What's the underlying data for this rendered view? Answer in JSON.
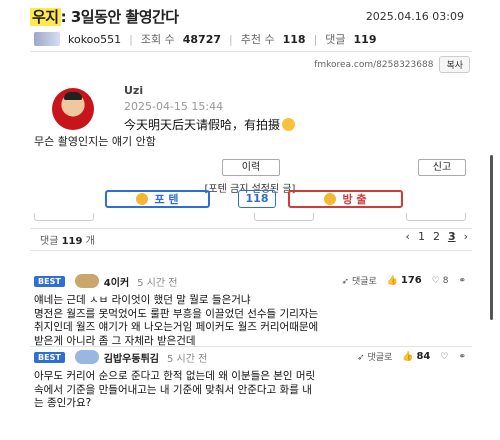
{
  "post": {
    "category": "우지",
    "title": ": 3일동안 촬영간다",
    "date": "2025.04.16 03:09",
    "author": "kokoo551",
    "views_label": "조회 수",
    "views": "48727",
    "recommend_label": "추천 수",
    "recommend": "118",
    "comments_label": "댓글",
    "comments": "119",
    "url": "fmkorea.com/8258323688",
    "copy_label": "복사"
  },
  "embed": {
    "username": "Uzi",
    "date": "2025-04-15 15:44",
    "text": "今天明天后天请假哈，有拍摄"
  },
  "caption": "무슨 촬영인지는 얘기 안함",
  "actions": {
    "history_label": "이력",
    "report_label": "신고",
    "notice": "[포텐 금지 설정된 글]",
    "upvote_label": "포 텐",
    "vote_count": "118",
    "downvote_label": "방 출"
  },
  "comment_bar": {
    "count_label": "댓글",
    "count": "119",
    "count_suffix": "개",
    "prev": "‹",
    "pages": [
      "1",
      "2",
      "3"
    ],
    "current_page": "3",
    "next": "›"
  },
  "comments": [
    {
      "badge": "BEST",
      "name": "4이커",
      "time": "5 시간 전",
      "reply_label": "댓글로",
      "likes": "176",
      "dislikes": "8",
      "avatar_color": "#c9a66b",
      "lines": [
        "얘네는 근데 ㅅㅂ 라이엇이 했던 말 뭘로 들은거냐",
        "명전은 월즈를 못먹었어도 룰판 부흥을 이끌었던 선수들 기리자는",
        "취지인데 월즈 얘기가 왜 나오는거임 페이커도 월즈 커리어때문에",
        "받은게 아니라 좀 그 자체라 받은건데"
      ]
    },
    {
      "badge": "BEST",
      "name": "김밥우동튀김",
      "time": "5 시간 전",
      "reply_label": "댓글로",
      "likes": "84",
      "dislikes": "",
      "avatar_color": "#9ab7e0",
      "lines": [
        "아무도 커리어 순으로 준다고 한적 없는데 왜 이분들은 본인 머릿",
        "속에서 기준을 만들어내고는 내 기준에 맞춰서 안준다고 화를 내",
        "는 종인가요?"
      ]
    }
  ]
}
